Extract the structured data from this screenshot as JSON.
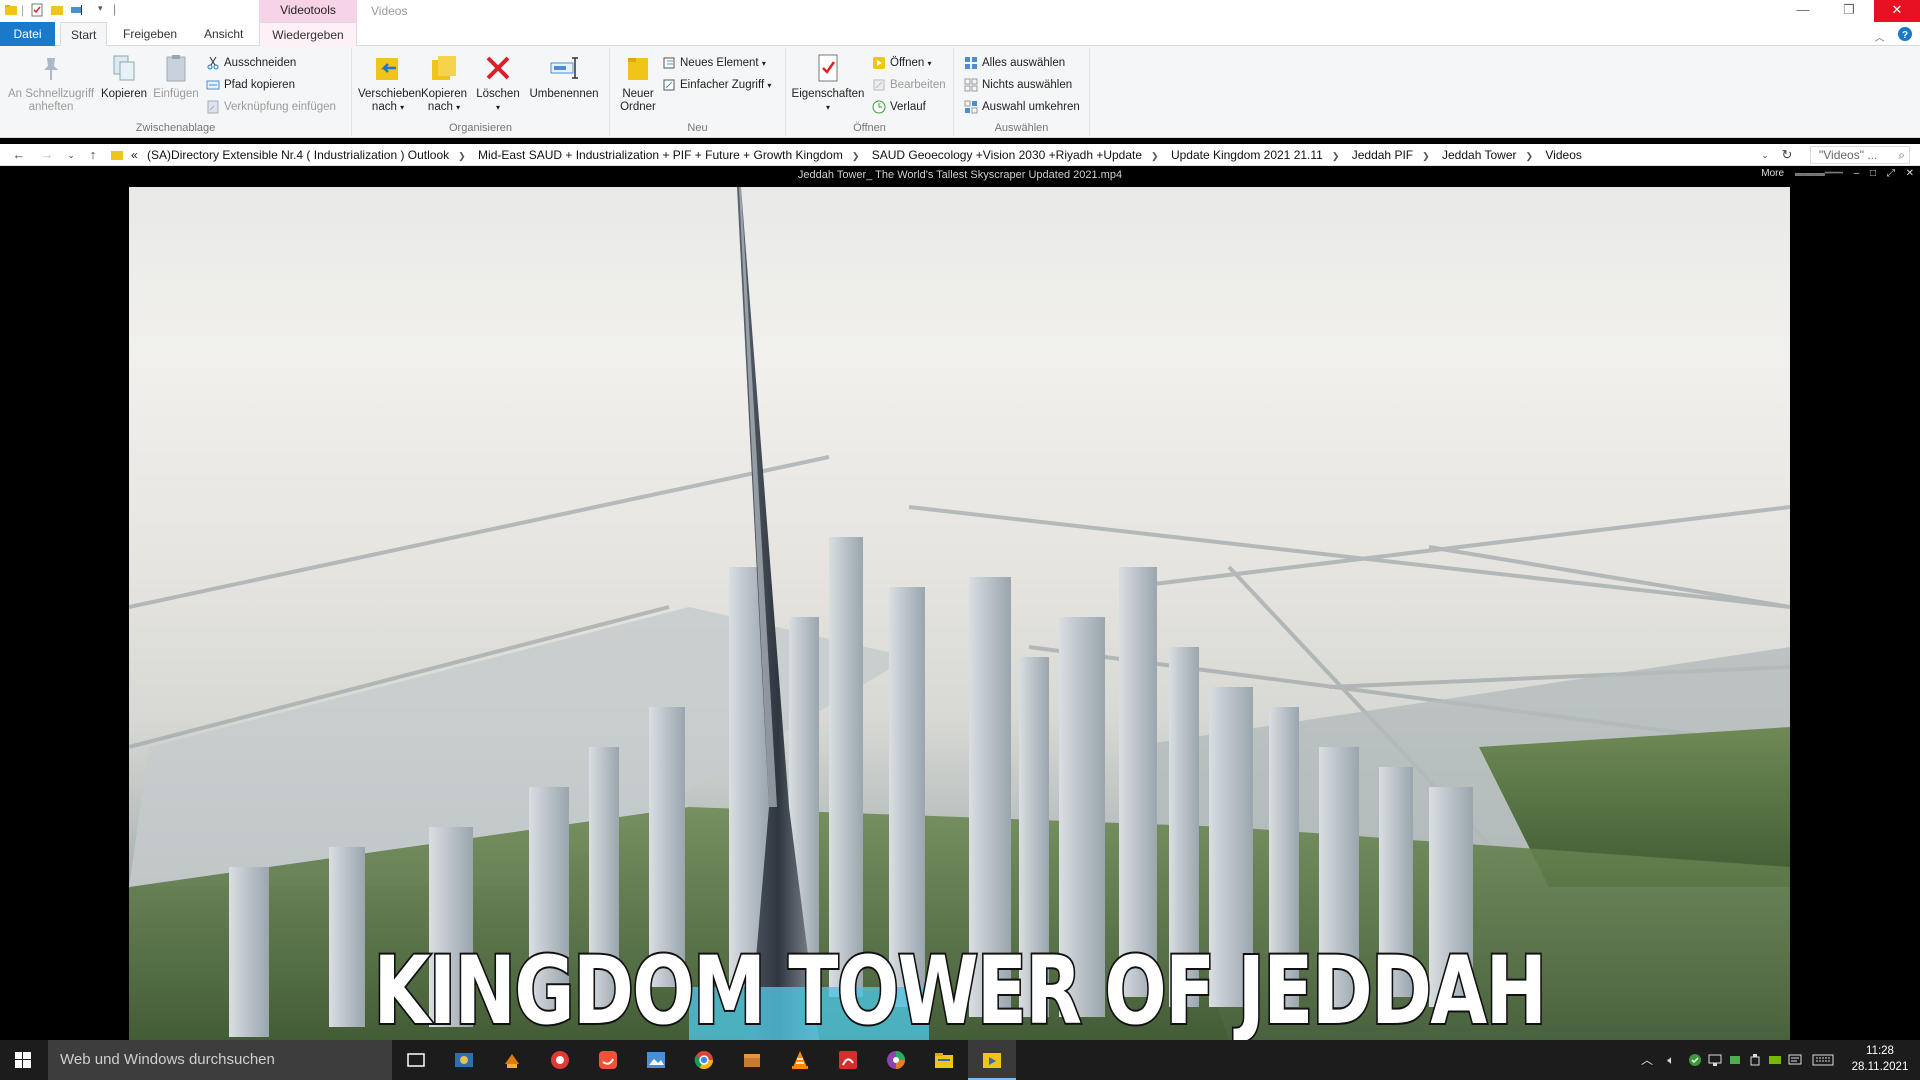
{
  "titlebar": {
    "context_tab_header": "Videotools",
    "title": "Videos",
    "minimize": "—",
    "restore": "❐",
    "close": "✕"
  },
  "ribbon_tabs": {
    "datei": "Datei",
    "start": "Start",
    "freigeben": "Freigeben",
    "ansicht": "Ansicht",
    "wiedergeben": "Wiedergeben"
  },
  "ribbon": {
    "zwischenablage": {
      "label": "Zwischenablage",
      "pin": "An Schnellzugriff anheften",
      "pin_l1": "An Schnellzugriff",
      "pin_l2": "anheften",
      "copy": "Kopieren",
      "paste": "Einfügen",
      "cut": "Ausschneiden",
      "copy_path": "Pfad kopieren",
      "paste_shortcut": "Verknüpfung einfügen"
    },
    "organisieren": {
      "label": "Organisieren",
      "move_l1": "Verschieben",
      "move_l2": "nach",
      "copyto_l1": "Kopieren",
      "copyto_l2": "nach",
      "delete": "Löschen",
      "rename": "Umbenennen"
    },
    "neu": {
      "label": "Neu",
      "new_folder_l1": "Neuer",
      "new_folder_l2": "Ordner",
      "new_item": "Neues Element",
      "easy_access": "Einfacher Zugriff"
    },
    "oeffnen": {
      "label": "Öffnen",
      "properties": "Eigenschaften",
      "open": "Öffnen",
      "edit": "Bearbeiten",
      "history": "Verlauf"
    },
    "auswaehlen": {
      "label": "Auswählen",
      "select_all": "Alles auswählen",
      "select_none": "Nichts auswählen",
      "invert": "Auswahl umkehren"
    }
  },
  "address": {
    "overflow": "«",
    "crumbs": [
      "(SA)Directory Extensible Nr.4 ( Industrialization )  Outlook",
      "Mid-East SAUD + Industrialization + PIF + Future + Growth Kingdom",
      "SAUD Geoecology +Vision 2030 +Riyadh +Update",
      "Update Kingdom 2021 21.11",
      "Jeddah PIF",
      "Jeddah Tower",
      "Videos"
    ],
    "search_placeholder": "\"Videos\" ..."
  },
  "player": {
    "title": "Jeddah Tower_ The World's Tallest Skyscraper Updated 2021.mp4",
    "more": "More",
    "video_caption": "KINGDOM TOWER OF JEDDAH"
  },
  "taskbar": {
    "search_placeholder": "Web und Windows durchsuchen",
    "time": "11:28",
    "date": "28.11.2021"
  },
  "colors": {
    "accent": "#1979ca",
    "close_red": "#e81123",
    "context_pink": "#f7d3e7",
    "taskbar": "#1c1c1c"
  }
}
